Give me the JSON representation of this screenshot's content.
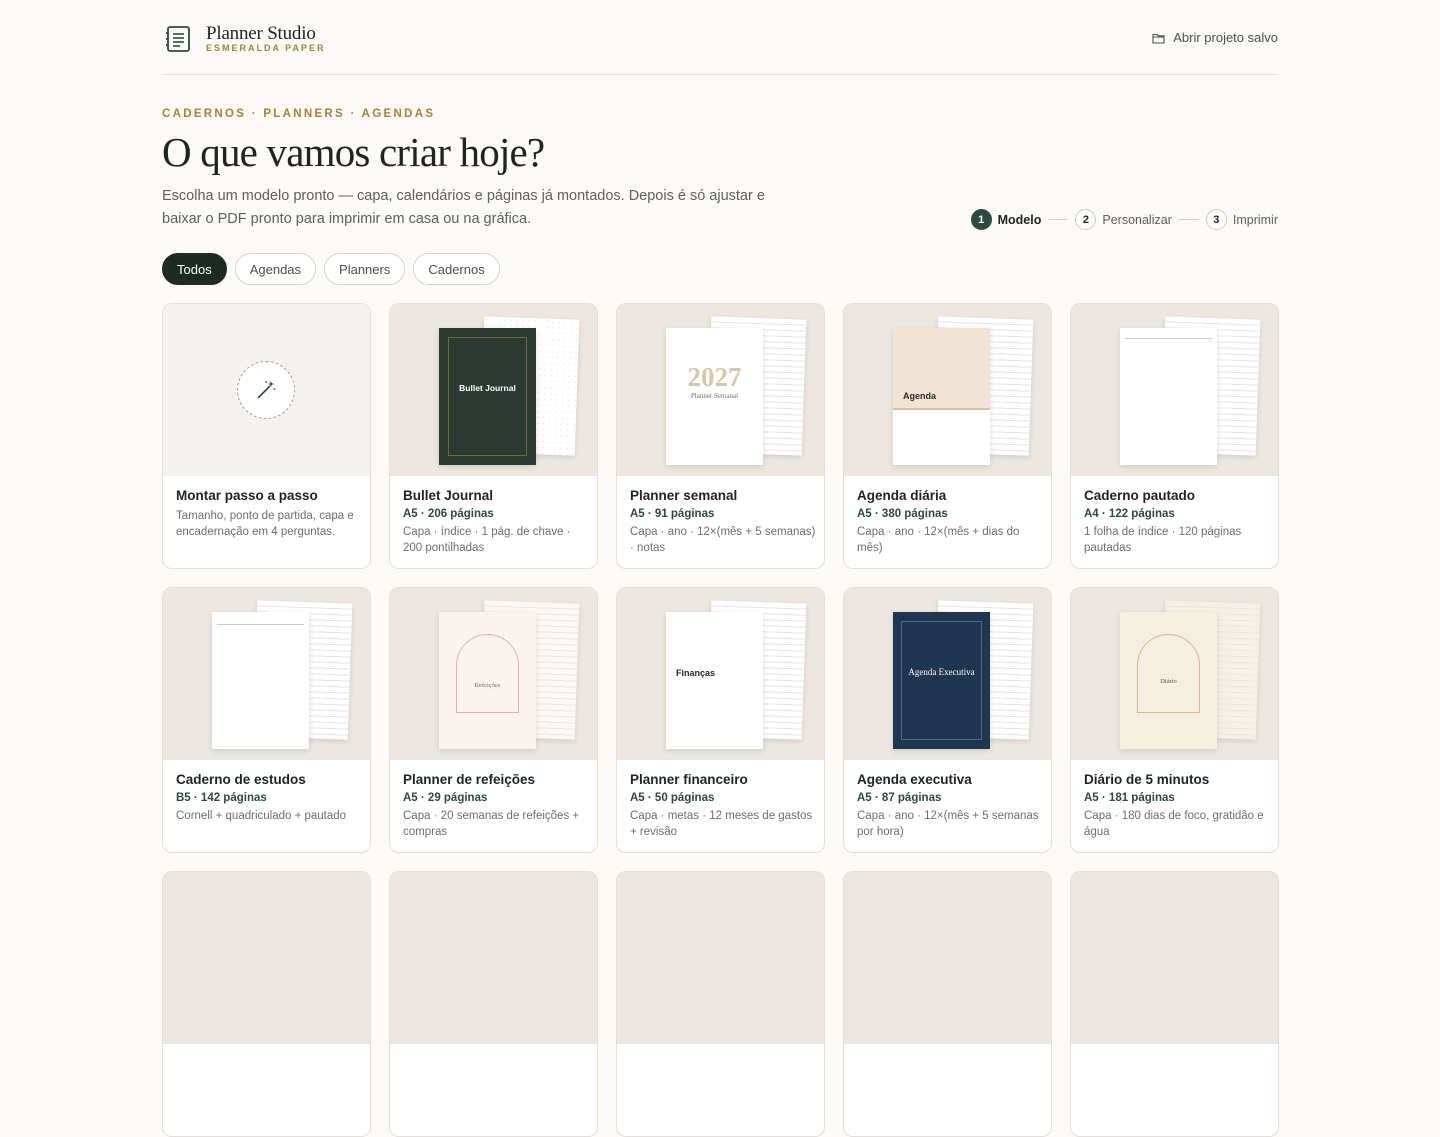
{
  "header": {
    "brand_name": "Planner Studio",
    "brand_sub": "ESMERALDA PAPER",
    "open_label": "Abrir projeto salvo"
  },
  "hero": {
    "eyebrow": "CADERNOS · PLANNERS · AGENDAS",
    "title": "O que vamos criar hoje?",
    "lede": "Escolha um modelo pronto — capa, calendários e páginas já montados. Depois é só ajustar e baixar o PDF pronto para imprimir em casa ou na gráfica."
  },
  "steps": [
    {
      "num": "1",
      "label": "Modelo",
      "active": true
    },
    {
      "num": "2",
      "label": "Personalizar",
      "active": false
    },
    {
      "num": "3",
      "label": "Imprimir",
      "active": false
    }
  ],
  "filters": [
    "Todos",
    "Agendas",
    "Planners",
    "Cadernos"
  ],
  "active_filter": "Todos",
  "cards": [
    {
      "title": "Montar passo a passo",
      "meta": "",
      "desc": "Tamanho, ponto de partida, capa e encadernação em 4 perguntas.",
      "cover": "wand-icon"
    },
    {
      "title": "Bullet Journal",
      "meta": "A5 · 206 páginas",
      "desc": "Capa · índice · 1 pág. de chave · 200 pontilhadas",
      "cover_text": "Bullet Journal"
    },
    {
      "title": "Planner semanal",
      "meta": "A5 · 91 páginas",
      "desc": "Capa · ano · 12×(mês + 5 semanas) · notas",
      "cover_year": "2027",
      "cover_text": "Planner Semanal"
    },
    {
      "title": "Agenda diária",
      "meta": "A5 · 380 páginas",
      "desc": "Capa · ano · 12×(mês + dias do mês)",
      "cover_text": "Agenda"
    },
    {
      "title": "Caderno pautado",
      "meta": "A4 · 122 páginas",
      "desc": "1 folha de índice · 120 páginas pautadas"
    },
    {
      "title": "Caderno de estudos",
      "meta": "B5 · 142 páginas",
      "desc": "Cornell + quadriculado + pautado"
    },
    {
      "title": "Planner de refeições",
      "meta": "A5 · 29 páginas",
      "desc": "Capa · 20 semanas de refeições + compras",
      "cover_text": "Refeições"
    },
    {
      "title": "Planner financeiro",
      "meta": "A5 · 50 páginas",
      "desc": "Capa · metas · 12 meses de gastos + revisão",
      "cover_text": "Finanças"
    },
    {
      "title": "Agenda executiva",
      "meta": "A5 · 87 páginas",
      "desc": "Capa · ano · 12×(mês + 5 semanas por hora)",
      "cover_text": "Agenda Executiva"
    },
    {
      "title": "Diário de 5 minutos",
      "meta": "A5 · 181 páginas",
      "desc": "Capa · 180 dias de foco, gratidão e água",
      "cover_text": "Diário"
    }
  ],
  "colors": {
    "accent_gold": "#a9803c",
    "primary_green": "#2c4a3f",
    "navy": "#1f3550",
    "cream": "#efe4d6"
  }
}
